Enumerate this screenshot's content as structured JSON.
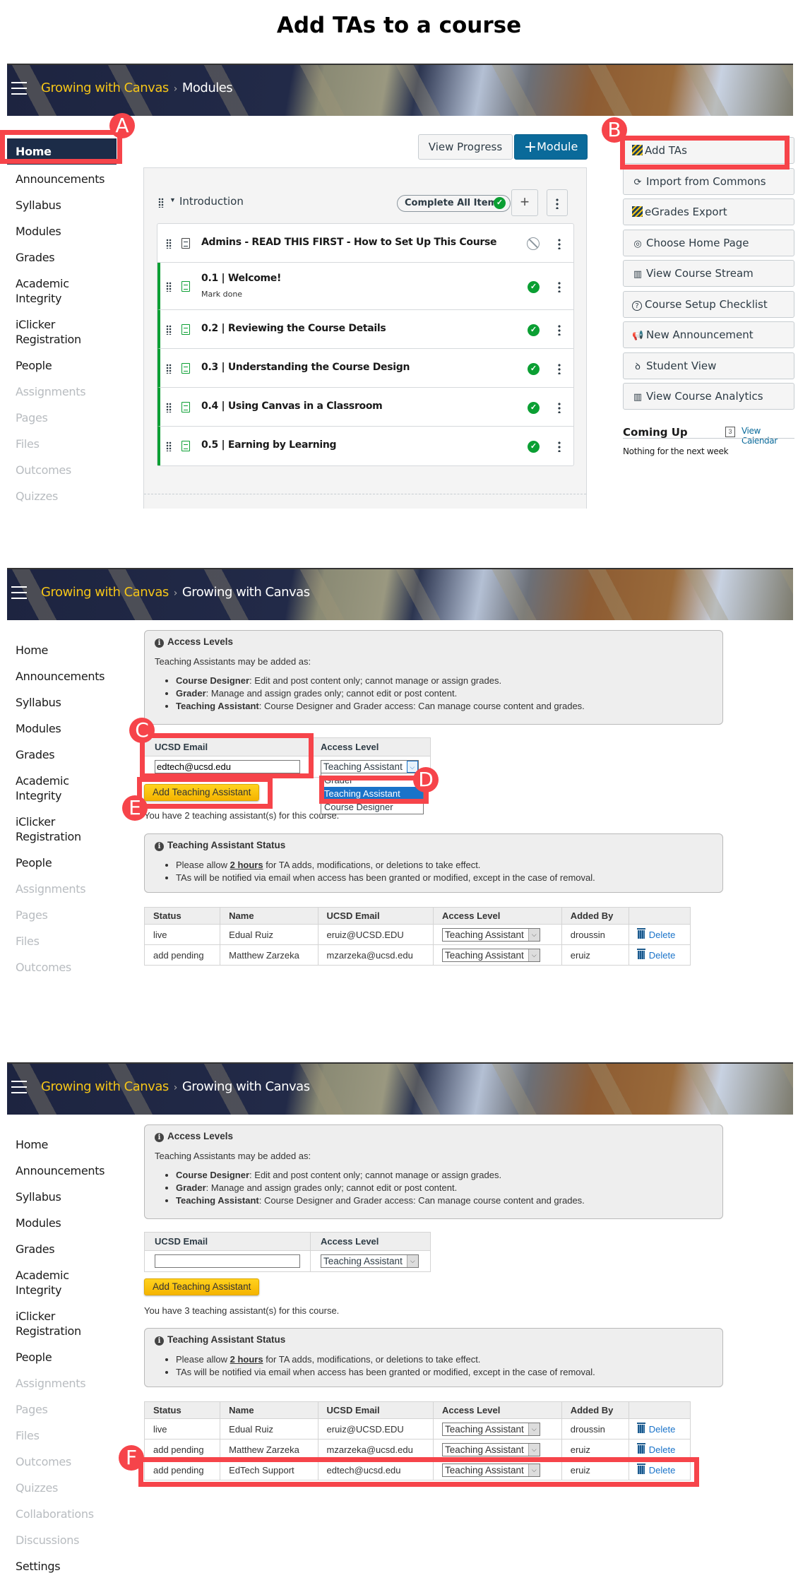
{
  "title": "Add TAs to a course",
  "colors": {
    "accent_red": "#f6444a",
    "canvas_blue": "#0a6a9a",
    "nav_active": "#1c2c48",
    "complete_green": "#0b9f33",
    "course_yellow": "#f5c518"
  },
  "annotations": {
    "a": "A",
    "b": "B",
    "c": "C",
    "d": "D",
    "e": "E",
    "f": "F"
  },
  "panel1": {
    "breadcrumb": {
      "course": "Growing with Canvas",
      "separator": "›",
      "page": "Modules"
    },
    "sidebar": [
      {
        "label": "Home",
        "state": "active"
      },
      {
        "label": "Announcements",
        "state": "enabled"
      },
      {
        "label": "Syllabus",
        "state": "enabled"
      },
      {
        "label": "Modules",
        "state": "enabled"
      },
      {
        "label": "Grades",
        "state": "enabled"
      },
      {
        "label": "Academic Integrity",
        "state": "enabled"
      },
      {
        "label": "iClicker Registration",
        "state": "enabled"
      },
      {
        "label": "People",
        "state": "enabled"
      },
      {
        "label": "Assignments",
        "state": "disabled"
      },
      {
        "label": "Pages",
        "state": "disabled"
      },
      {
        "label": "Files",
        "state": "disabled"
      },
      {
        "label": "Outcomes",
        "state": "disabled"
      },
      {
        "label": "Quizzes",
        "state": "disabled"
      }
    ],
    "toolbar": {
      "view_progress": "View Progress",
      "add_module": "Module",
      "add_module_icon": "+"
    },
    "module": {
      "name": "Introduction",
      "complete_all": "Complete All Items",
      "add_icon": "+",
      "items": [
        {
          "title": "Admins - READ THIS FIRST - How to Set Up This Course",
          "sub": "",
          "status": "unpublished"
        },
        {
          "title": "0.1 | Welcome!",
          "sub": "Mark done",
          "status": "published"
        },
        {
          "title": "0.2 | Reviewing the Course Details",
          "sub": "",
          "status": "published"
        },
        {
          "title": "0.3 | Understanding the Course Design",
          "sub": "",
          "status": "published"
        },
        {
          "title": "0.4 | Using Canvas in a Classroom",
          "sub": "",
          "status": "published"
        },
        {
          "title": "0.5 | Earning by Learning",
          "sub": "",
          "status": "published"
        }
      ]
    },
    "right_sidebar": {
      "buttons": [
        {
          "label": "Add TAs",
          "icon": "ucsd-logo-icon"
        },
        {
          "label": "Import from Commons",
          "icon": "commons-icon"
        },
        {
          "label": "eGrades Export",
          "icon": "ucsd-logo-icon"
        },
        {
          "label": "Choose Home Page",
          "icon": "target-icon"
        },
        {
          "label": "View Course Stream",
          "icon": "chart-icon"
        },
        {
          "label": "Course Setup Checklist",
          "icon": "question-icon"
        },
        {
          "label": "New Announcement",
          "icon": "megaphone-icon"
        },
        {
          "label": "Student View",
          "icon": "glasses-icon"
        },
        {
          "label": "View Course Analytics",
          "icon": "chart-icon"
        }
      ],
      "coming_up": "Coming Up",
      "view_calendar": "View Calendar",
      "calendar_day": "3",
      "nothing": "Nothing for the next week"
    }
  },
  "access_levels": {
    "heading": "Access Levels",
    "intro": "Teaching Assistants may be added as:",
    "levels": [
      {
        "name": "Course Designer",
        "desc": ": Edit and post content only; cannot manage or assign grades."
      },
      {
        "name": "Grader",
        "desc": ": Manage and assign grades only; cannot edit or post content."
      },
      {
        "name": "Teaching Assistant",
        "desc": ": Course Designer and Grader access: Can manage course content and grades."
      }
    ]
  },
  "form": {
    "email_header": "UCSD Email",
    "access_header": "Access Level",
    "add_button": "Add Teaching Assistant"
  },
  "status_box": {
    "heading": "Teaching Assistant Status",
    "line1_pre": "Please allow ",
    "line1_em": "2 hours",
    "line1_post": " for TA adds, modifications, or deletions to take effect.",
    "line2": "TAs will be notified via email when access has been granted or modified, except in the case of removal."
  },
  "ta_table_headers": [
    "Status",
    "Name",
    "UCSD Email",
    "Access Level",
    "Added By",
    ""
  ],
  "delete_label": "Delete",
  "panel2": {
    "breadcrumb": {
      "course": "Growing with Canvas",
      "separator": "›",
      "page": "Growing with Canvas"
    },
    "sidebar": [
      {
        "label": "Home",
        "state": "enabled"
      },
      {
        "label": "Announcements",
        "state": "enabled"
      },
      {
        "label": "Syllabus",
        "state": "enabled"
      },
      {
        "label": "Modules",
        "state": "enabled"
      },
      {
        "label": "Grades",
        "state": "enabled"
      },
      {
        "label": "Academic Integrity",
        "state": "enabled"
      },
      {
        "label": "iClicker Registration",
        "state": "enabled"
      },
      {
        "label": "People",
        "state": "enabled"
      },
      {
        "label": "Assignments",
        "state": "disabled"
      },
      {
        "label": "Pages",
        "state": "disabled"
      },
      {
        "label": "Files",
        "state": "disabled"
      },
      {
        "label": "Outcomes",
        "state": "disabled"
      }
    ],
    "email_value": "edtech@ucsd.edu",
    "access_value": "Teaching Assistant",
    "dropdown_options": [
      "Grader",
      "Teaching Assistant",
      "Course Designer"
    ],
    "dropdown_selected": "Teaching Assistant",
    "count_text": "You have 2 teaching assistant(s) for this course.",
    "rows": [
      {
        "status": "live",
        "name": "Edual Ruiz",
        "email": "eruiz@UCSD.EDU",
        "access": "Teaching Assistant",
        "added_by": "droussin"
      },
      {
        "status": "add pending",
        "name": "Matthew Zarzeka",
        "email": "mzarzeka@ucsd.edu",
        "access": "Teaching Assistant",
        "added_by": "eruiz"
      }
    ]
  },
  "panel3": {
    "breadcrumb": {
      "course": "Growing with Canvas",
      "separator": "›",
      "page": "Growing with Canvas"
    },
    "sidebar": [
      {
        "label": "Home",
        "state": "enabled"
      },
      {
        "label": "Announcements",
        "state": "enabled"
      },
      {
        "label": "Syllabus",
        "state": "enabled"
      },
      {
        "label": "Modules",
        "state": "enabled"
      },
      {
        "label": "Grades",
        "state": "enabled"
      },
      {
        "label": "Academic Integrity",
        "state": "enabled"
      },
      {
        "label": "iClicker Registration",
        "state": "enabled"
      },
      {
        "label": "People",
        "state": "enabled"
      },
      {
        "label": "Assignments",
        "state": "disabled"
      },
      {
        "label": "Pages",
        "state": "disabled"
      },
      {
        "label": "Files",
        "state": "disabled"
      },
      {
        "label": "Outcomes",
        "state": "disabled"
      },
      {
        "label": "Quizzes",
        "state": "disabled"
      },
      {
        "label": "Collaborations",
        "state": "disabled"
      },
      {
        "label": "Discussions",
        "state": "disabled"
      },
      {
        "label": "Settings",
        "state": "enabled"
      }
    ],
    "email_value": "",
    "access_value": "Teaching Assistant",
    "count_text": "You have 3 teaching assistant(s) for this course.",
    "rows": [
      {
        "status": "live",
        "name": "Edual Ruiz",
        "email": "eruiz@UCSD.EDU",
        "access": "Teaching Assistant",
        "added_by": "droussin"
      },
      {
        "status": "add pending",
        "name": "Matthew Zarzeka",
        "email": "mzarzeka@ucsd.edu",
        "access": "Teaching Assistant",
        "added_by": "eruiz"
      },
      {
        "status": "add pending",
        "name": "EdTech Support",
        "email": "edtech@ucsd.edu",
        "access": "Teaching Assistant",
        "added_by": "eruiz"
      }
    ]
  }
}
